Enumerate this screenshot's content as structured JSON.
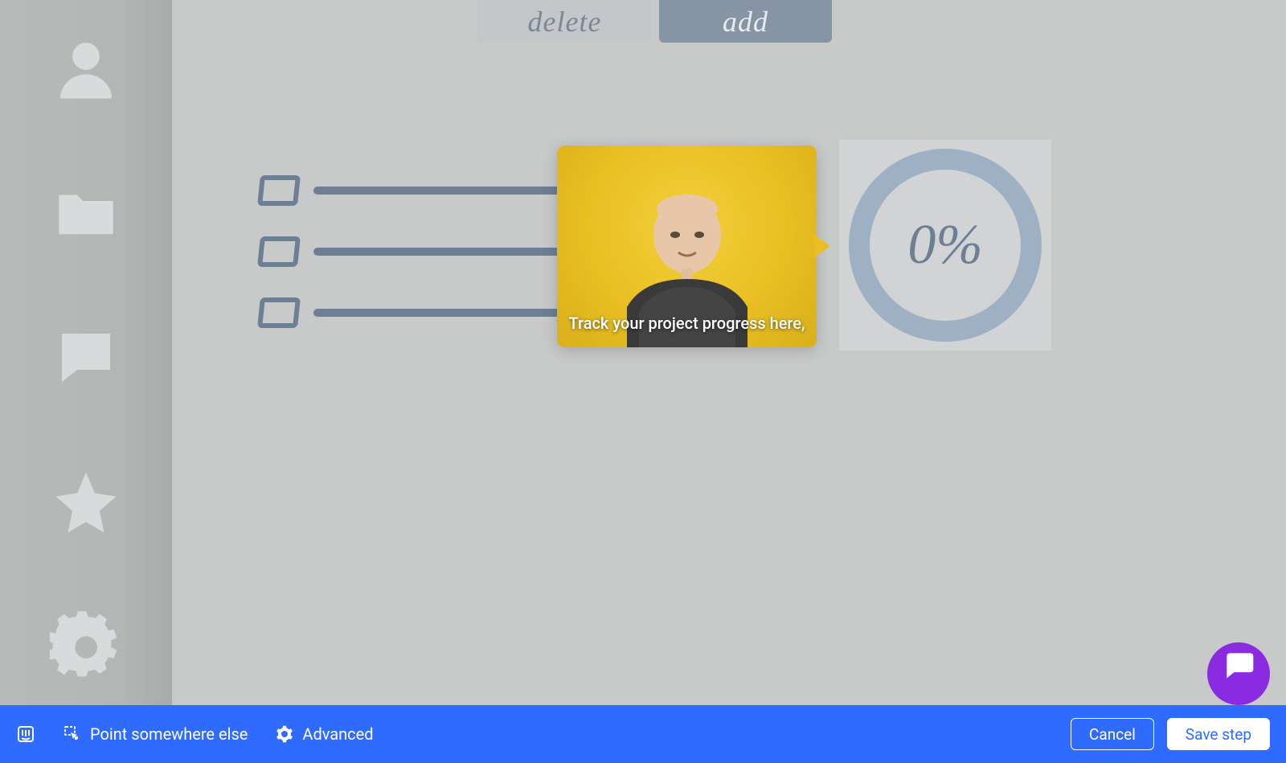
{
  "sidebar": {
    "items": [
      {
        "name": "profile-icon"
      },
      {
        "name": "folder-icon"
      },
      {
        "name": "chat-icon"
      },
      {
        "name": "star-icon"
      },
      {
        "name": "gear-icon"
      }
    ]
  },
  "header": {
    "delete_label": "delete",
    "add_label": "add"
  },
  "video": {
    "caption": "Track your project progress here,"
  },
  "progress": {
    "value_text": "0%"
  },
  "toolbar": {
    "point_label": "Point somewhere else",
    "advanced_label": "Advanced",
    "cancel_label": "Cancel",
    "save_label": "Save step"
  }
}
